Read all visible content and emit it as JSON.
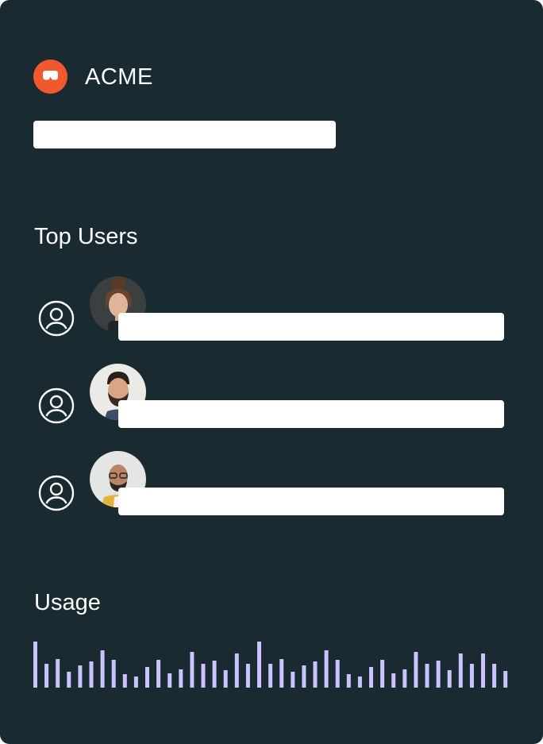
{
  "brand": {
    "name": "ACME",
    "logo_icon": "visor-logo-icon",
    "accent": "#f0592d"
  },
  "search": {
    "value": ""
  },
  "top_users": {
    "title": "Top Users",
    "users": [
      {
        "icon": "user-circle-icon",
        "photo": "woman-portrait",
        "name": ""
      },
      {
        "icon": "user-circle-icon",
        "photo": "bearded-man-portrait",
        "name": ""
      },
      {
        "icon": "user-circle-icon",
        "photo": "glasses-man-portrait",
        "name": ""
      }
    ]
  },
  "usage": {
    "title": "Usage",
    "bar_color": "#c9c3ff"
  },
  "chart_data": {
    "type": "bar",
    "title": "",
    "xlabel": "",
    "ylabel": "",
    "ylim": [
      0,
      60
    ],
    "values": [
      58,
      30,
      36,
      20,
      28,
      33,
      47,
      35,
      17,
      14,
      26,
      35,
      18,
      23,
      45,
      30,
      34,
      22,
      43,
      30,
      58,
      30,
      36,
      20,
      28,
      33,
      47,
      35,
      17,
      14,
      26,
      35,
      18,
      23,
      45,
      30,
      34,
      22,
      43,
      30,
      43,
      30,
      21
    ]
  },
  "colors": {
    "background": "#192a30",
    "panel_text": "#ffffff"
  }
}
